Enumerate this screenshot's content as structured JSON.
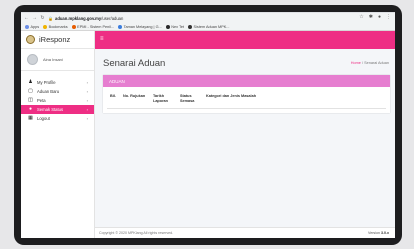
{
  "browser": {
    "url_domain": "aduan.mpklang.gov.my",
    "url_path": "/user/aduan",
    "bookmarks": [
      {
        "label": "Apps",
        "color": "#6b8ee6"
      },
      {
        "label": "Bookmarks",
        "color": "#f0b400"
      },
      {
        "label": "EPMI - Sistem Penil...",
        "color": "#e65c00"
      },
      {
        "label": "Taman Melayang | G...",
        "color": "#3b7ddd"
      },
      {
        "label": "Nex Tet",
        "color": "#2a2a2a"
      },
      {
        "label": "Sistem Aduan MPK...",
        "color": "#333333"
      }
    ]
  },
  "sidebar": {
    "brand": "iResponz",
    "user_name": "Aina Insani",
    "items": [
      {
        "label": "My Profile",
        "icon": "user-icon"
      },
      {
        "label": "Aduan Baru",
        "icon": "file-icon"
      },
      {
        "label": "Peta",
        "icon": "map-icon"
      },
      {
        "label": "Semak Status",
        "icon": "check-status-icon"
      },
      {
        "label": "Logout",
        "icon": "logout-icon"
      }
    ]
  },
  "header": {
    "menu_icon": "hamburger-icon"
  },
  "main": {
    "title": "Senarai Aduan",
    "breadcrumb": {
      "home": "Home",
      "separator": "/",
      "current": "Senarai Aduan"
    },
    "card_title": "ADUAN",
    "columns": [
      "Bil.",
      "No. Rujukan",
      "Tarikh Laporan",
      "Status Semasa",
      "Kategori dan Jenis Masalah"
    ]
  },
  "footer": {
    "copyright": "Copyright © 2020 MPKlang All rights reserved.",
    "version_label": "Version",
    "version_value": "3.0.x"
  },
  "colors": {
    "accent": "#ee2e84",
    "card_header": "#e67ed0"
  }
}
